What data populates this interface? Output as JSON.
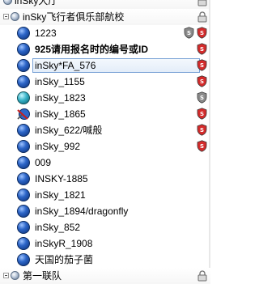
{
  "tree": {
    "root": {
      "label": "inSky大厅",
      "icon": "lock-icon"
    },
    "channel": {
      "label": "inSky飞行者俱乐部航校",
      "icon": "lock-icon"
    },
    "users": [
      {
        "name": "1223",
        "bold": false,
        "status": "blue",
        "badges": [
          "grey-shield",
          "red-shield"
        ]
      },
      {
        "name": "925请用报名时的编号或ID",
        "bold": true,
        "status": "blue",
        "badges": [
          "red-shield"
        ]
      },
      {
        "name": "inSky*FA_576",
        "bold": false,
        "status": "blue",
        "badges": [
          "red-shield"
        ],
        "selected": true
      },
      {
        "name": "inSky_1155",
        "bold": false,
        "status": "blue",
        "badges": [
          "red-shield"
        ]
      },
      {
        "name": "inSky_1823",
        "bold": false,
        "status": "teal",
        "badges": [
          "grey-shield"
        ]
      },
      {
        "name": "inSky_1865",
        "bold": false,
        "status": "muted",
        "badges": [
          "red-shield"
        ]
      },
      {
        "name": "inSky_622/喊般",
        "bold": false,
        "status": "blue",
        "badges": [
          "red-shield"
        ]
      },
      {
        "name": "inSky_992",
        "bold": false,
        "status": "blue",
        "badges": [
          "red-shield"
        ]
      },
      {
        "name": "009",
        "bold": false,
        "status": "blue",
        "badges": []
      },
      {
        "name": "INSKY-1885",
        "bold": false,
        "status": "blue",
        "badges": []
      },
      {
        "name": "inSky_1821",
        "bold": false,
        "status": "blue",
        "badges": []
      },
      {
        "name": "inSky_1894/dragonfly",
        "bold": false,
        "status": "blue",
        "badges": []
      },
      {
        "name": "inSky_852",
        "bold": false,
        "status": "blue",
        "badges": []
      },
      {
        "name": "inSkyR_1908",
        "bold": false,
        "status": "blue",
        "badges": []
      },
      {
        "name": "天国的茄子菌",
        "bold": false,
        "status": "blue",
        "badges": []
      }
    ],
    "next_channel": {
      "label": "第一联队",
      "icon": "lock-icon"
    }
  },
  "colors": {
    "red_shield": "#d42b2b",
    "grey_shield": "#8a8a8a",
    "selection_border": "#7aa2d6"
  }
}
